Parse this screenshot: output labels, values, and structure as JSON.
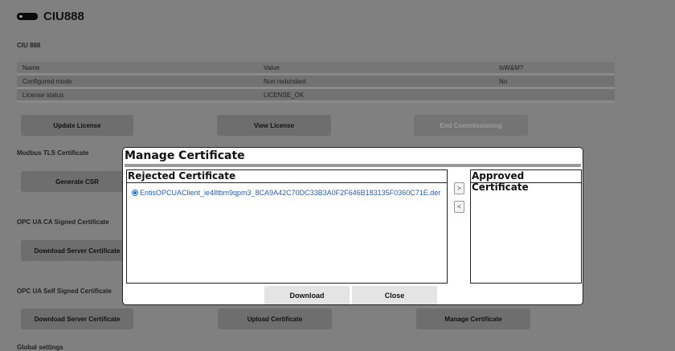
{
  "app": {
    "title": "CIU888",
    "device_icon": "device-icon"
  },
  "device_section": "CIU 888",
  "info_table": {
    "headers": [
      "Name",
      "Value",
      "IsW&M?"
    ],
    "rows": [
      {
        "name": "Configured mode",
        "value": "Non redundant",
        "iswm": "No"
      },
      {
        "name": "License status",
        "value": "LICENSE_OK",
        "iswm": ""
      }
    ]
  },
  "license_buttons": {
    "update": "Update License",
    "view": "View License",
    "end": "End Commissioning"
  },
  "modbus": {
    "heading": "Modbus TLS Certificate",
    "generate": "Generate CSR"
  },
  "opc_ca": {
    "heading": "OPC UA CA Signed Certificate",
    "download": "Download Server Certificate"
  },
  "opc_self": {
    "heading": "OPC UA Self Signed Certificate",
    "download": "Download Server Certificate",
    "upload": "Upload Certificate",
    "manage": "Manage Certificate"
  },
  "global": {
    "heading": "Global settings"
  },
  "modal": {
    "title": "Manage Certificate",
    "rejected_title": "Rejected Certificate",
    "approved_title": "Approved Certificate",
    "rejected_items": [
      "EntisOPCUAClient_ie4lltbm9qpm3_8CA9A42C70DC33B3A0F2F646B183135F0360C71E.der"
    ],
    "move_right": ">",
    "move_left": "<",
    "download": "Download",
    "close": "Close"
  },
  "colors": {
    "overlay": "#808080",
    "accent": "#1a73e8",
    "link": "#2a5db0"
  }
}
